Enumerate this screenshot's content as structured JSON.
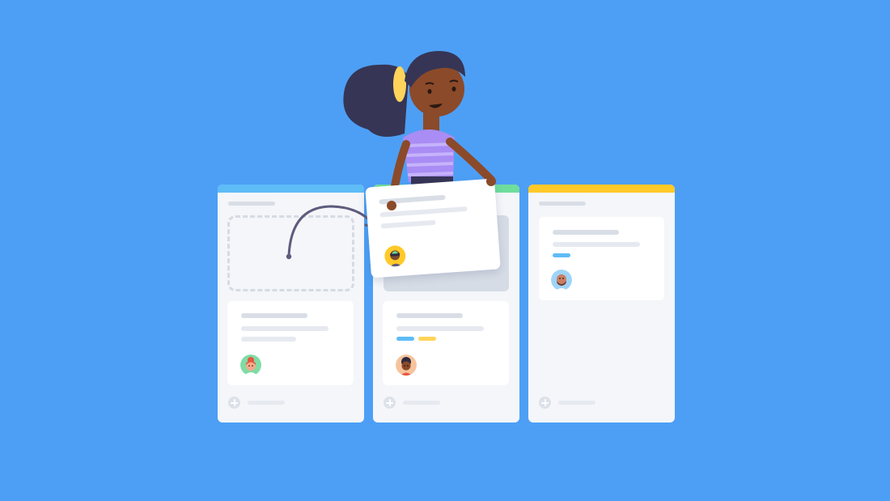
{
  "scene": {
    "description_free": true,
    "colors": {
      "background": "#4d9ff5",
      "column_left_accent": "#5ebcf7",
      "column_mid_accent": "#6fdd9c",
      "column_right_accent": "#ffc928",
      "tag_blue": "#5ebcf7",
      "tag_yellow": "#ffd45a",
      "hair": "#363556",
      "skin": "#8b4a2a",
      "shirt": "#a98cf4",
      "headband": "#ffd45a"
    },
    "icons": [
      "arrow-icon",
      "plus-icon",
      "avatar-icon"
    ]
  },
  "board": {
    "columns": [
      {
        "name": "left",
        "accent": "#5ebcf7"
      },
      {
        "name": "middle",
        "accent": "#6fdd9c"
      },
      {
        "name": "right",
        "accent": "#ffc928"
      }
    ]
  }
}
